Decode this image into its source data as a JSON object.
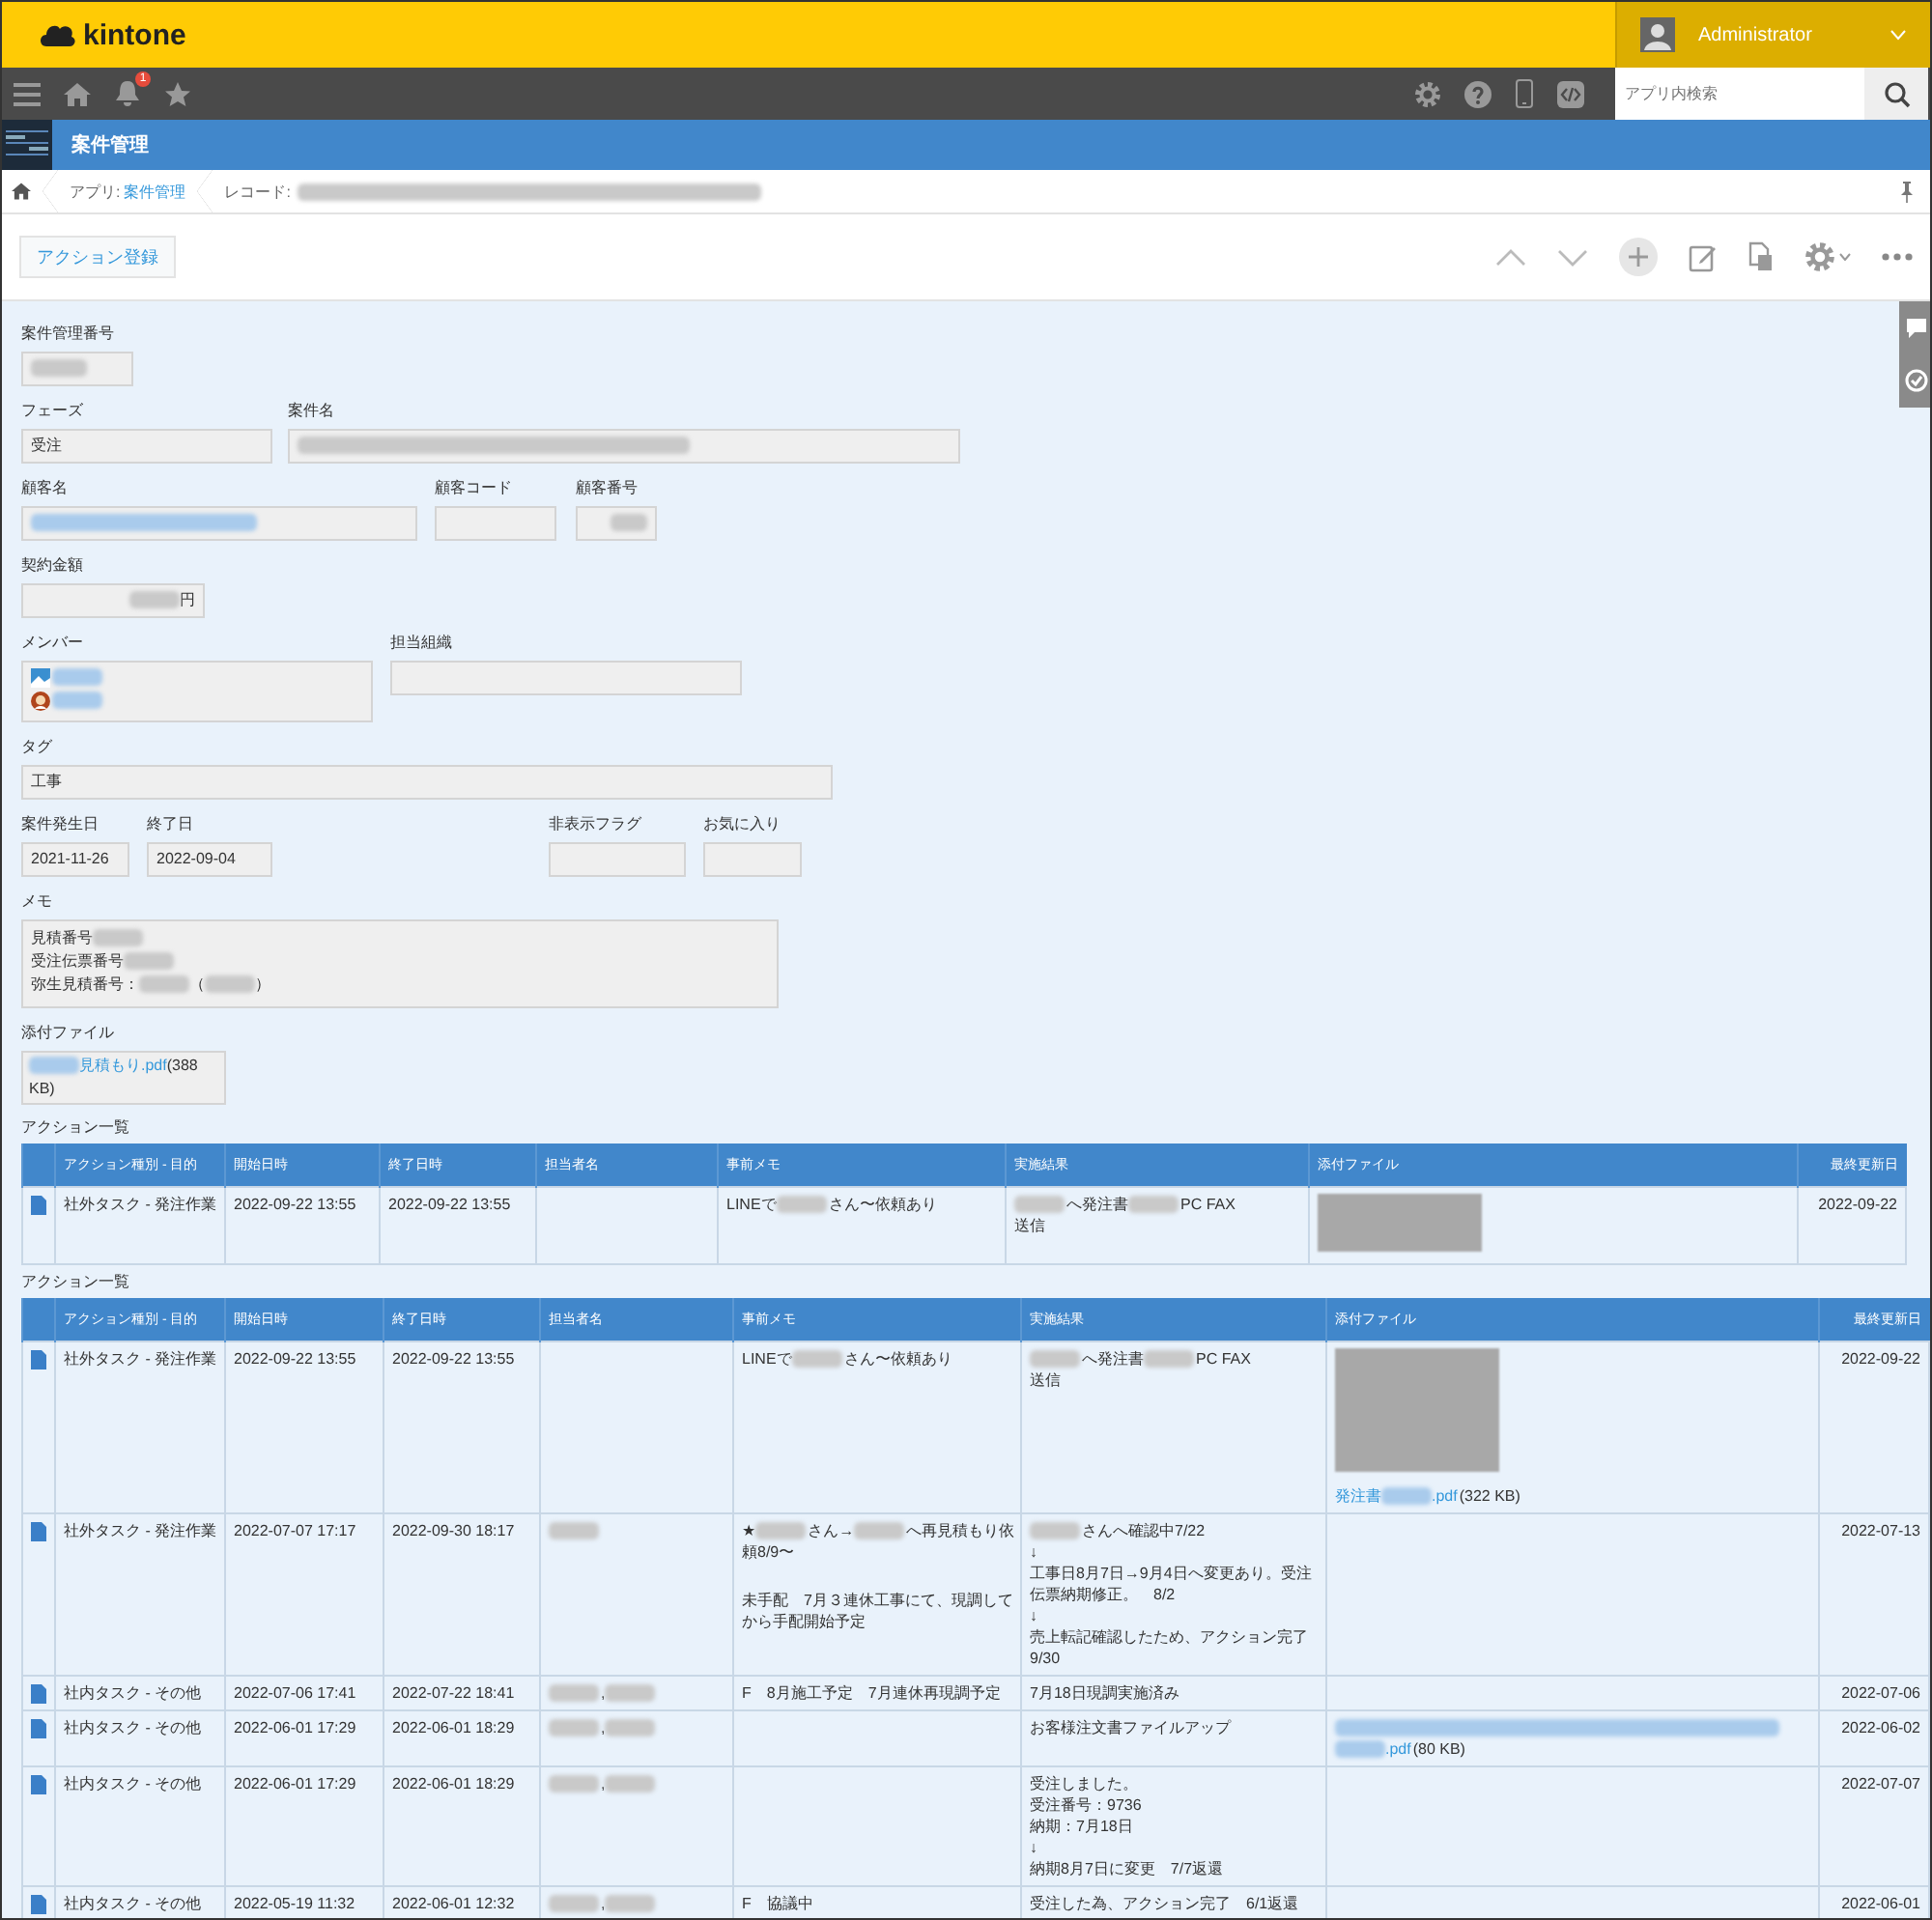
{
  "header": {
    "logo": "kintone",
    "user": "Administrator"
  },
  "nav": {
    "notification_count": "1",
    "search": {
      "placeholder": "アプリ内検索"
    }
  },
  "app": {
    "title": "案件管理"
  },
  "breadcrumb": {
    "app_label": "アプリ:",
    "app_link": "案件管理",
    "record_label": "レコード:"
  },
  "toolbar": {
    "action_button": "アクション登録"
  },
  "form": {
    "rows": [
      [
        {
          "label": "案件管理番号",
          "kind": "text",
          "value": [
            [
              {
                "kind": "blur"
              }
            ]
          ]
        }
      ],
      [
        {
          "label": "フェーズ",
          "kind": "text",
          "value": [
            [
              "受注"
            ]
          ]
        },
        {
          "label": "案件名",
          "kind": "text",
          "value": [
            [
              {
                "kind": "blur"
              }
            ]
          ]
        }
      ],
      [
        {
          "label": "顧客名",
          "kind": "text",
          "value": [
            [
              {
                "kind": "blur_link"
              }
            ]
          ]
        },
        {
          "label": "顧客コード",
          "kind": "text"
        },
        {
          "label": "顧客番号",
          "kind": "number",
          "value": [
            [
              {
                "kind": "blur"
              }
            ]
          ]
        }
      ],
      [
        {
          "label": "契約金額",
          "kind": "number",
          "value": [
            [
              {
                "kind": "blur"
              },
              "円"
            ]
          ]
        }
      ],
      [
        {
          "label": "メンバー",
          "kind": "users",
          "value": [
            [
              {
                "kind": "photo_avatar"
              },
              {
                "kind": "blur_link"
              }
            ],
            [
              {
                "kind": "person_avatar"
              },
              {
                "kind": "blur_link"
              }
            ]
          ]
        },
        {
          "label": "担当組織",
          "kind": "text"
        }
      ],
      [
        {
          "label": "タグ",
          "kind": "text",
          "value": [
            [
              "工事"
            ]
          ]
        }
      ],
      [
        {
          "label": "案件発生日",
          "kind": "text",
          "value": [
            [
              "2021-11-26"
            ]
          ]
        },
        {
          "label": "終了日",
          "kind": "text",
          "value": [
            [
              "2022-09-04"
            ]
          ]
        },
        {
          "label": "非表示フラグ",
          "kind": "text"
        },
        {
          "label": "お気に入り",
          "kind": "text"
        }
      ],
      [
        {
          "label": "メモ",
          "kind": "multiline",
          "value": [
            [
              "見積番号",
              {
                "kind": "blur"
              }
            ],
            [
              "受注伝票番号",
              {
                "kind": "blur"
              }
            ],
            [
              "弥生見積番号：",
              {
                "kind": "blur"
              },
              "（",
              {
                "kind": "blur"
              },
              "）"
            ]
          ]
        }
      ],
      [
        {
          "label": "添付ファイル",
          "kind": "file",
          "value": [
            [
              {
                "kind": "blur_link"
              },
              {
                "kind": "link",
                "text": "見積もり.pdf"
              },
              "(388"
            ],
            [
              "KB)"
            ]
          ]
        }
      ]
    ]
  },
  "tables": [
    {
      "title": "アクション一覧",
      "columns": [
        "アクション種別 - 目的",
        "開始日時",
        "終了日時",
        "担当者名",
        "事前メモ",
        "実施結果",
        "添付ファイル",
        "最終更新日"
      ],
      "rows": [
        {
          "type": "社外タスク - 発注作業",
          "start": "2022-09-22 13:55",
          "end": "2022-09-22 13:55",
          "memo": [
            [
              "LINEで",
              {
                "kind": "blur"
              },
              "さん〜依頼あり"
            ]
          ],
          "result": [
            [
              {
                "kind": "blur"
              },
              "へ発注書",
              {
                "kind": "blur"
              },
              "PC FAX"
            ],
            [
              "送信"
            ]
          ],
          "file": [
            [
              {
                "kind": "thumbnail"
              }
            ]
          ],
          "updated": "2022-09-22"
        }
      ]
    },
    {
      "title": "アクション一覧",
      "columns": [
        "アクション種別 - 目的",
        "開始日時",
        "終了日時",
        "担当者名",
        "事前メモ",
        "実施結果",
        "添付ファイル",
        "最終更新日"
      ],
      "rows": [
        {
          "type": "社外タスク - 発注作業",
          "start": "2022-09-22 13:55",
          "end": "2022-09-22 13:55",
          "memo": [
            [
              "LINEで",
              {
                "kind": "blur"
              },
              "さん〜依頼あり"
            ]
          ],
          "result": [
            [
              {
                "kind": "blur"
              },
              "へ発注書",
              {
                "kind": "blur"
              },
              "PC FAX"
            ],
            [
              "送信"
            ]
          ],
          "file": [
            [
              {
                "kind": "thumbnail"
              }
            ],
            [
              {
                "kind": "link",
                "text": "発注書"
              },
              {
                "kind": "blur_link"
              },
              {
                "kind": "link",
                "text": ".pdf"
              },
              "(322 KB)"
            ]
          ],
          "updated": "2022-09-22"
        },
        {
          "type": "社外タスク - 発注作業",
          "start": "2022-07-07 17:17",
          "end": "2022-09-30 18:17",
          "person": [
            [
              {
                "kind": "blur"
              }
            ]
          ],
          "memo": [
            [
              "★",
              {
                "kind": "blur"
              },
              "さん→",
              {
                "kind": "blur"
              },
              "へ再見積もり依"
            ],
            [
              "頼8/9〜"
            ],
            [
              {
                "kind": "blank"
              }
            ],
            [
              "未手配　7月３連休工事にて、現調して"
            ],
            [
              "から手配開始予定"
            ]
          ],
          "result": [
            [
              {
                "kind": "blur"
              },
              "さんへ確認中7/22"
            ],
            [
              "↓"
            ],
            [
              "工事日8月7日→9月4日へ変更あり。受注"
            ],
            [
              "伝票納期修正。　8/2"
            ],
            [
              "↓"
            ],
            [
              "売上転記確認したため、アクション完了"
            ],
            [
              "9/30"
            ]
          ],
          "updated": "2022-07-13"
        },
        {
          "type": "社内タスク - その他",
          "start": "2022-07-06 17:41",
          "end": "2022-07-22 18:41",
          "person": [
            [
              {
                "kind": "blur"
              },
              ",",
              {
                "kind": "blur"
              }
            ]
          ],
          "memo": [
            [
              "F　8月施工予定　7月連休再現調予定"
            ]
          ],
          "result": [
            [
              "7月18日現調実施済み"
            ]
          ],
          "updated": "2022-07-06"
        },
        {
          "type": "社内タスク - その他",
          "start": "2022-06-01 17:29",
          "end": "2022-06-01 18:29",
          "person": [
            [
              {
                "kind": "blur"
              },
              ",",
              {
                "kind": "blur"
              }
            ]
          ],
          "result": [
            [
              "お客様注文書ファイルアップ"
            ]
          ],
          "file": [
            [
              {
                "kind": "blur_link"
              }
            ],
            [
              {
                "kind": "blur_link"
              },
              {
                "kind": "link",
                "text": ".pdf"
              },
              "(80 KB)"
            ]
          ],
          "updated": "2022-06-02"
        },
        {
          "type": "社内タスク - その他",
          "start": "2022-06-01 17:29",
          "end": "2022-06-01 18:29",
          "person": [
            [
              {
                "kind": "blur"
              },
              ",",
              {
                "kind": "blur"
              }
            ]
          ],
          "result": [
            [
              "受注しました。"
            ],
            [
              "受注番号：9736"
            ],
            [
              "納期：7月18日"
            ],
            [
              "↓"
            ],
            [
              "納期8月7日に変更　7/7返還"
            ]
          ],
          "updated": "2022-07-07"
        },
        {
          "type": "社内タスク - その他",
          "start": "2022-05-19 11:32",
          "end": "2022-06-01 12:32",
          "person": [
            [
              {
                "kind": "blur"
              },
              ",",
              {
                "kind": "blur"
              }
            ]
          ],
          "memo": [
            [
              "F　協議中"
            ]
          ],
          "result": [
            [
              "受注した為、アクション完了　6/1返還"
            ]
          ],
          "updated": "2022-06-01"
        }
      ]
    }
  ]
}
